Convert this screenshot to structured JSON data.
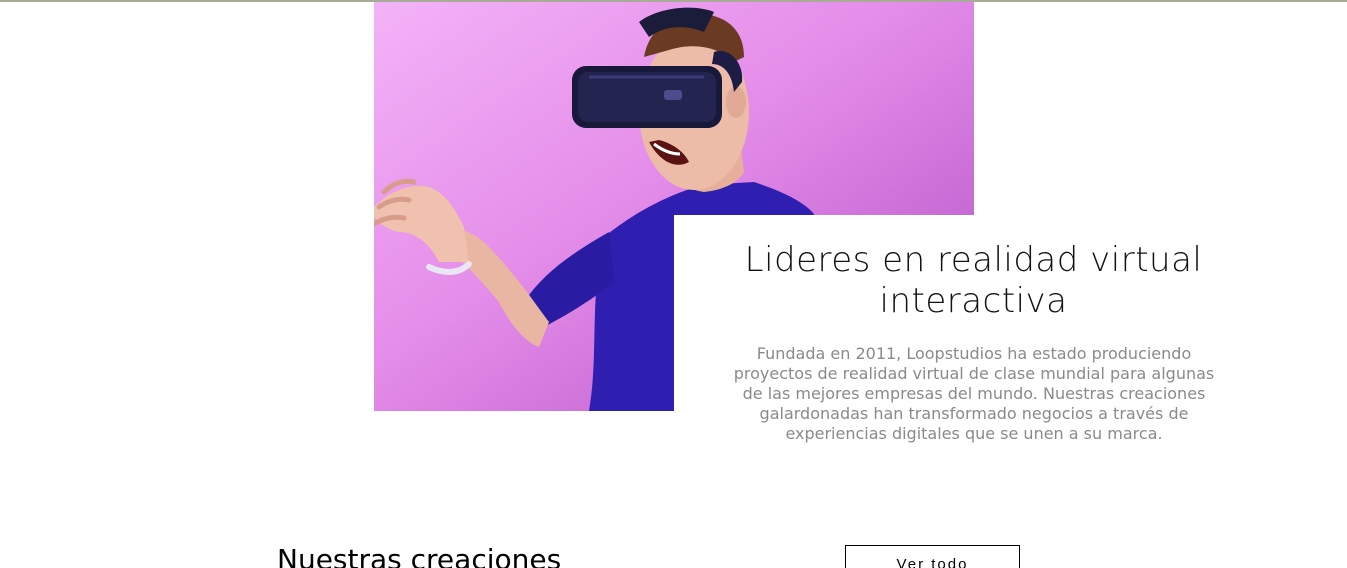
{
  "colors": {
    "top_rule": "#a8ab96",
    "hero_gradient_start": "#f1a8f7",
    "hero_gradient_end": "#b556c9",
    "title_text": "#111111",
    "body_text": "#8a8a8a"
  },
  "hero": {
    "image_alt": "man-with-vr-headset",
    "title": "Lideres en realidad virtual interactiva",
    "description": "Fundada en 2011, Loopstudios ha estado produciendo proyectos de realidad virtual de clase mundial para algunas de las mejores empresas del mundo. Nuestras creaciones galardonadas han transformado negocios a través de experiencias digitales que se unen a su marca."
  },
  "creations": {
    "title": "Nuestras creaciones",
    "see_all_label": "Ver todo"
  }
}
